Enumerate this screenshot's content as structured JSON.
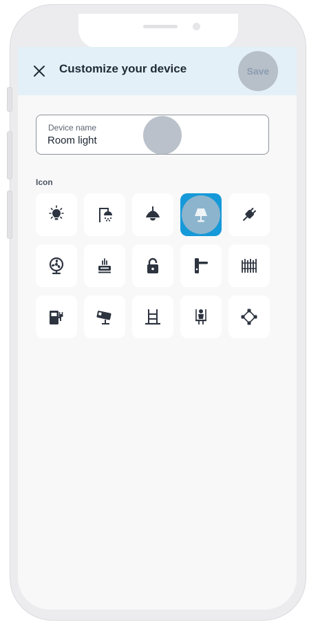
{
  "header": {
    "title": "Customize your device",
    "save_label": "Save"
  },
  "device_name_field": {
    "label": "Device name",
    "value": "Room light"
  },
  "icon_section": {
    "label": "Icon",
    "icons": [
      {
        "name": "light-bulb-icon",
        "selected": false
      },
      {
        "name": "shower-icon",
        "selected": false
      },
      {
        "name": "pendant-lamp-icon",
        "selected": false
      },
      {
        "name": "table-lamp-icon",
        "selected": true
      },
      {
        "name": "plug-icon",
        "selected": false
      },
      {
        "name": "fan-icon",
        "selected": false
      },
      {
        "name": "router-icon",
        "selected": false
      },
      {
        "name": "padlock-icon",
        "selected": false
      },
      {
        "name": "door-handle-icon",
        "selected": false
      },
      {
        "name": "fence-icon",
        "selected": false
      },
      {
        "name": "ev-charger-icon",
        "selected": false
      },
      {
        "name": "security-camera-icon",
        "selected": false
      },
      {
        "name": "pool-ladder-icon",
        "selected": false
      },
      {
        "name": "swing-icon",
        "selected": false
      },
      {
        "name": "network-nodes-icon",
        "selected": false
      }
    ]
  },
  "colors": {
    "accent": "#1699d9",
    "header_bg": "#e4f0f7",
    "icon": "#2d3440"
  }
}
